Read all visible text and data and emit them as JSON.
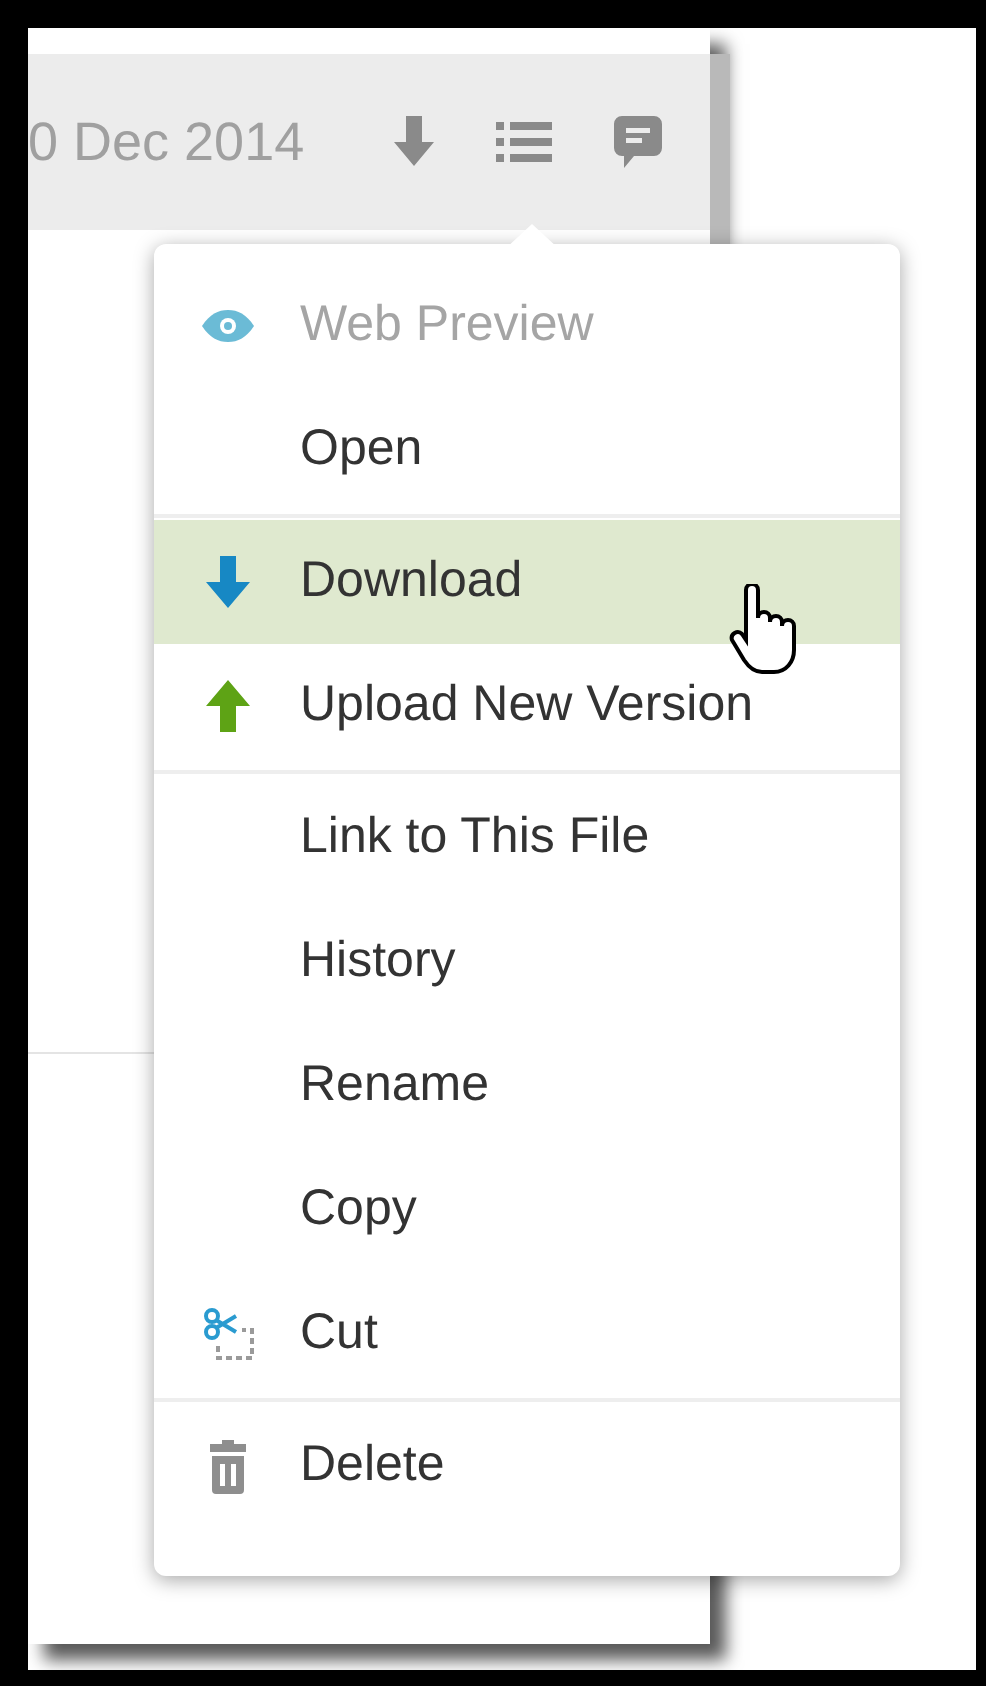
{
  "toolbar": {
    "date": "0 Dec 2014"
  },
  "menu": {
    "sections": [
      [
        {
          "label": "Web Preview",
          "kind": "eye",
          "disabled": true,
          "highlighted": false
        },
        {
          "label": "Open",
          "kind": "plain",
          "disabled": false,
          "highlighted": false
        }
      ],
      [
        {
          "label": "Download",
          "kind": "download",
          "disabled": false,
          "highlighted": true
        },
        {
          "label": "Upload New Version",
          "kind": "upload",
          "disabled": false,
          "highlighted": false
        }
      ],
      [
        {
          "label": "Link to This File",
          "kind": "plain",
          "disabled": false,
          "highlighted": false
        },
        {
          "label": "History",
          "kind": "plain",
          "disabled": false,
          "highlighted": false
        },
        {
          "label": "Rename",
          "kind": "plain",
          "disabled": false,
          "highlighted": false
        },
        {
          "label": "Copy",
          "kind": "plain",
          "disabled": false,
          "highlighted": false
        },
        {
          "label": "Cut",
          "kind": "cut",
          "disabled": false,
          "highlighted": false
        }
      ],
      [
        {
          "label": "Delete",
          "kind": "delete",
          "disabled": false,
          "highlighted": false
        }
      ]
    ]
  }
}
